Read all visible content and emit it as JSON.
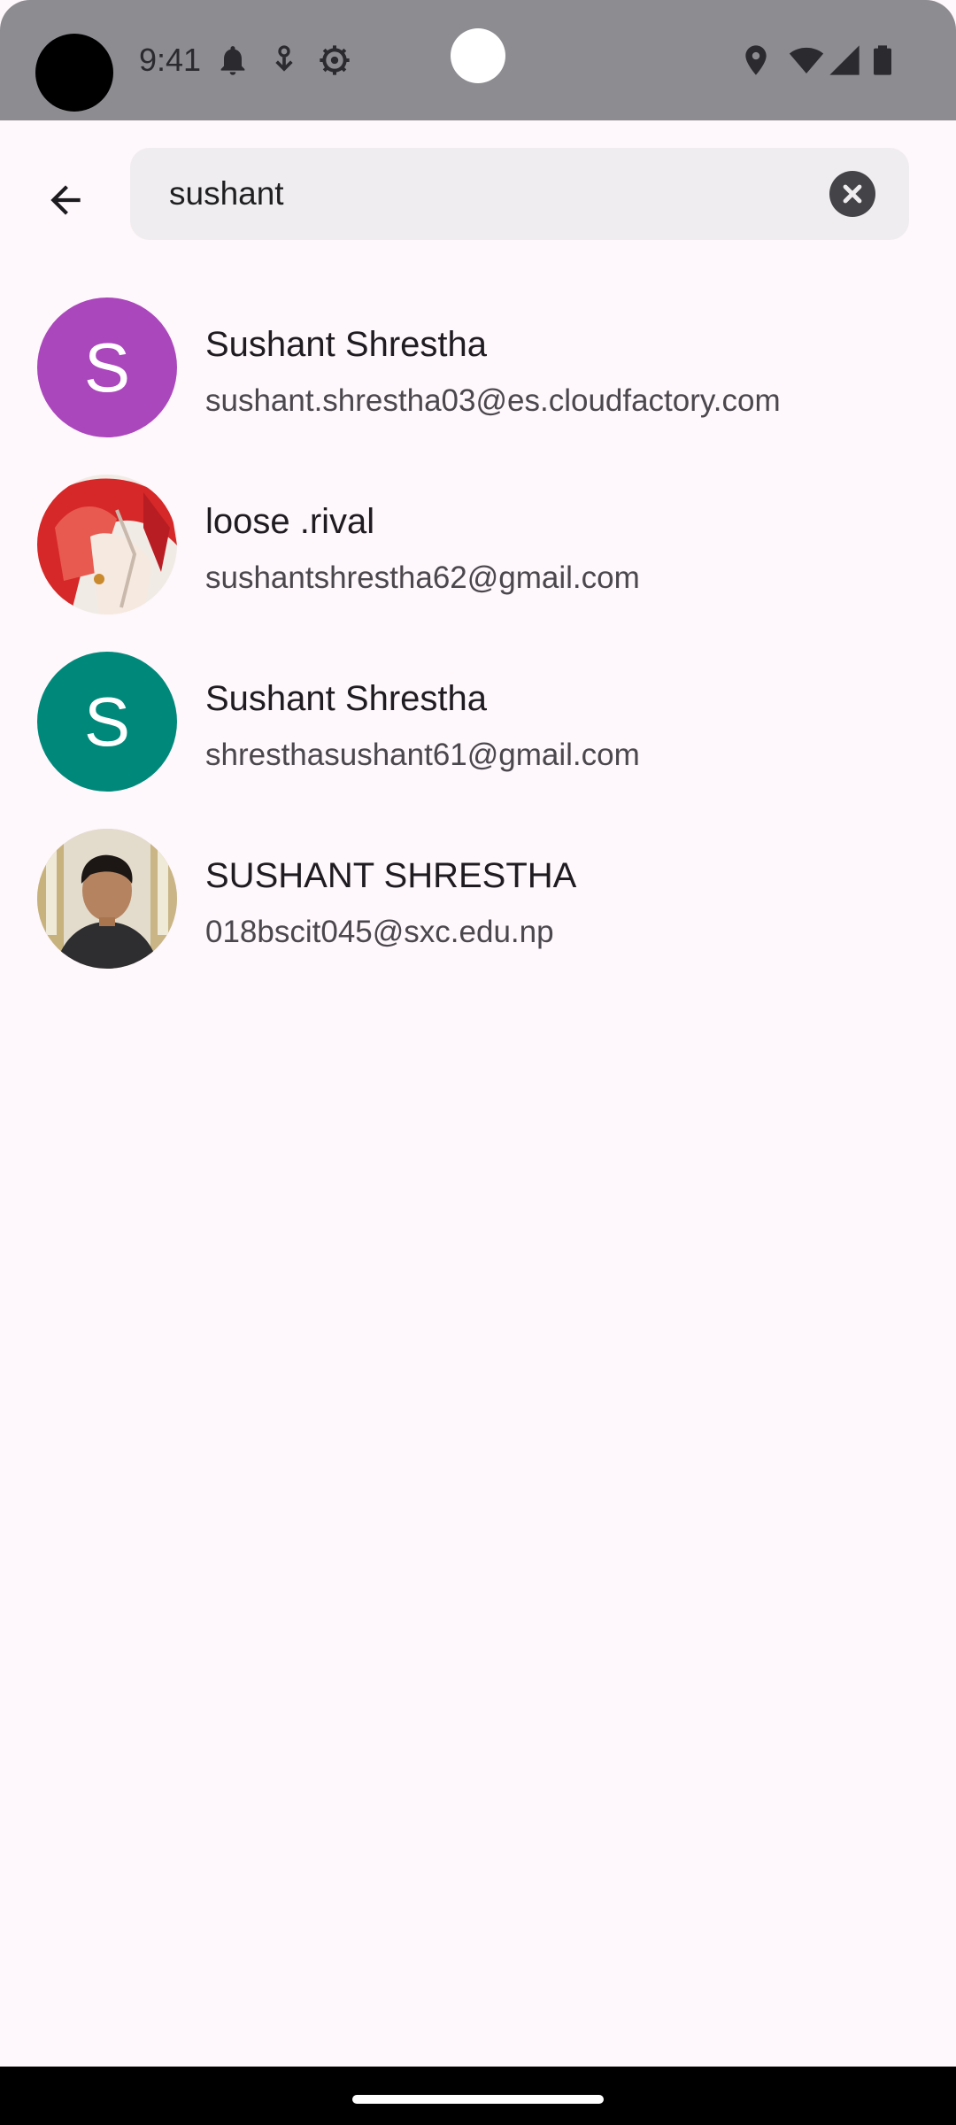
{
  "status_bar": {
    "time": "9:41",
    "icons_left": [
      "notification-bell-icon",
      "download-icon",
      "settings-gear-icon"
    ],
    "icons_right": [
      "location-pin-icon",
      "wifi-icon",
      "cellular-signal-icon",
      "battery-icon"
    ]
  },
  "search": {
    "query": "sushant",
    "back_icon": "arrow-back-icon",
    "clear_icon": "clear-circle-icon"
  },
  "results": [
    {
      "name": "Sushant Shrestha",
      "email": "sushant.shrestha03@es.cloudfactory.com",
      "avatar_type": "initial",
      "avatar_letter": "S",
      "avatar_color": "#ab47bc"
    },
    {
      "name": "loose .rival",
      "email": "sushantshrestha62@gmail.com",
      "avatar_type": "photo-anime",
      "avatar_color": "#e53935"
    },
    {
      "name": "Sushant Shrestha",
      "email": "shresthasushant61@gmail.com",
      "avatar_type": "initial",
      "avatar_letter": "S",
      "avatar_color": "#00897b"
    },
    {
      "name": "SUSHANT SHRESTHA",
      "email": "018bscit045@sxc.edu.np",
      "avatar_type": "photo-person",
      "avatar_color": "#3a3330"
    }
  ]
}
